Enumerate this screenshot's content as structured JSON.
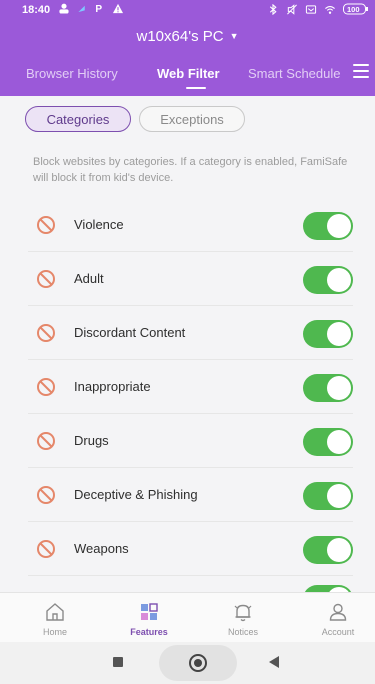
{
  "statusbar": {
    "time": "18:40",
    "left_icons": [
      "person-icon",
      "signal-arrow-icon",
      "p-icon",
      "warning-icon"
    ],
    "right_icons": [
      "bluetooth-icon",
      "mute-icon",
      "box-icon",
      "wifi-icon",
      "battery-icon"
    ],
    "battery_text": "100"
  },
  "header": {
    "device_title": "w10x64's PC",
    "caret": "▼",
    "tabs": [
      {
        "label": "Browser History",
        "active": false
      },
      {
        "label": "Web Filter",
        "active": true
      },
      {
        "label": "Smart Schedule",
        "active": false
      }
    ]
  },
  "segments": {
    "categories": "Categories",
    "exceptions": "Exceptions",
    "selected": "Categories"
  },
  "description": "Block websites by categories. If a category is enabled, FamiSafe will block it from kid's device.",
  "categories": [
    {
      "label": "Violence",
      "enabled": true
    },
    {
      "label": "Adult",
      "enabled": true
    },
    {
      "label": "Discordant Content",
      "enabled": true
    },
    {
      "label": "Inappropriate",
      "enabled": true
    },
    {
      "label": "Drugs",
      "enabled": true
    },
    {
      "label": "Deceptive & Phishing",
      "enabled": true
    },
    {
      "label": "Weapons",
      "enabled": true
    }
  ],
  "bottom_nav": [
    {
      "label": "Home",
      "icon": "home-icon",
      "active": false
    },
    {
      "label": "Features",
      "icon": "features-grid-icon",
      "active": true
    },
    {
      "label": "Notices",
      "icon": "bell-icon",
      "active": false
    },
    {
      "label": "Account",
      "icon": "person-icon",
      "active": false
    }
  ],
  "colors": {
    "header": "#9b59d9",
    "toggle_on": "#4fb84f",
    "ban_icon": "#e5876a",
    "accent": "#7d4faf"
  }
}
